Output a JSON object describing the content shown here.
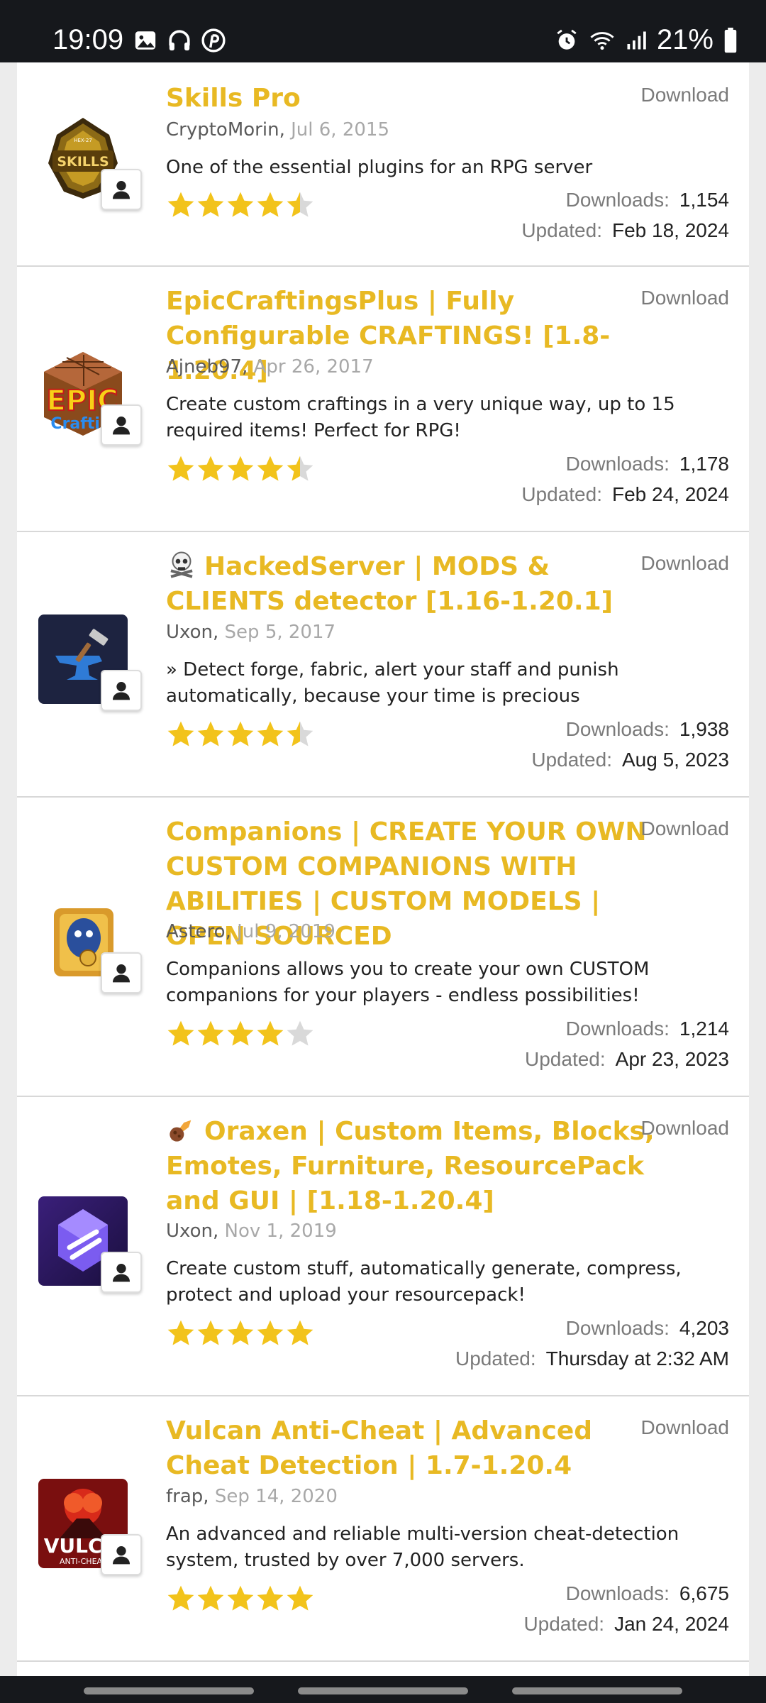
{
  "status_bar": {
    "time": "19:09",
    "battery": "21%",
    "left_icons": [
      "image-icon",
      "headphones-icon",
      "pinterest-icon"
    ],
    "right_icons": [
      "alarm-icon",
      "wifi-icon",
      "signal-icon",
      "battery-icon"
    ]
  },
  "colors": {
    "title": "#e8b923",
    "star": "#f2c31b",
    "star_empty": "#d9d9d9",
    "status_bg": "#16181c"
  },
  "download_label": "Download",
  "downloads_label": "Downloads:",
  "updated_label": "Updated:",
  "resources": [
    {
      "title": "Skills Pro",
      "author": "CryptoMorin",
      "date": "Jul 6, 2015",
      "description": "One of the essential plugins for an RPG server",
      "rating": 4.5,
      "downloads": "1,154",
      "updated": "Feb 18, 2024",
      "icon": "skills-pro-logo-icon",
      "thumb_text": "SKILLS",
      "thumb_subtext": "HEX-27"
    },
    {
      "title": "EpicCraftingsPlus | Fully Configurable CRAFTINGS! [1.8-1.20.4]",
      "author": "Ajneb97",
      "date": "Apr 26, 2017",
      "description": "Create custom craftings in a very unique way, up to 15 required items! Perfect for RPG!",
      "rating": 4.5,
      "downloads": "1,178",
      "updated": "Feb 24, 2024",
      "icon": "crafting-table-icon",
      "thumb_text": "EPIC",
      "thumb_subtext": "Craftin"
    },
    {
      "title": "HackedServer | MODS & CLIENTS detector [1.16-1.20.1]",
      "title_emoji": "skull-crossbones-icon",
      "author": "Uxon",
      "date": "Sep 5, 2017",
      "description": "» Detect forge, fabric, alert your staff and punish automatically, because your time is precious",
      "rating": 4.5,
      "downloads": "1,938",
      "updated": "Aug 5, 2023",
      "icon": "anvil-hammer-icon"
    },
    {
      "title": "Companions | CREATE YOUR OWN CUSTOM COMPANIONS WITH ABILITIES | CUSTOM MODELS | OPEN SOURCED",
      "author": "Astero",
      "date": "Jul 9, 2019",
      "description": "Companions allows you to create your own CUSTOM companions for your players - endless possibilities!",
      "rating": 4,
      "downloads": "1,214",
      "updated": "Apr 23, 2023",
      "icon": "companion-creature-icon"
    },
    {
      "title": "Oraxen | Custom Items, Blocks, Emotes, Furniture, ResourcePack and GUI | [1.18-1.20.4]",
      "title_emoji": "comet-icon",
      "author": "Uxon",
      "date": "Nov 1, 2019",
      "description": "Create custom stuff, automatically generate, compress, protect and upload your resourcepack!",
      "rating": 5,
      "downloads": "4,203",
      "updated": "Thursday at 2:32 AM",
      "icon": "crystal-gem-icon"
    },
    {
      "title": "Vulcan Anti-Cheat | Advanced Cheat Detection | 1.7-1.20.4",
      "author": "frap",
      "date": "Sep 14, 2020",
      "description": "An advanced and reliable multi-version cheat-detection system, trusted by over 7,000 servers.",
      "rating": 5,
      "downloads": "6,675",
      "updated": "Jan 24, 2024",
      "icon": "volcano-logo-icon",
      "thumb_text": "VULCA",
      "thumb_subtext": "ANTI-CHEA"
    }
  ]
}
